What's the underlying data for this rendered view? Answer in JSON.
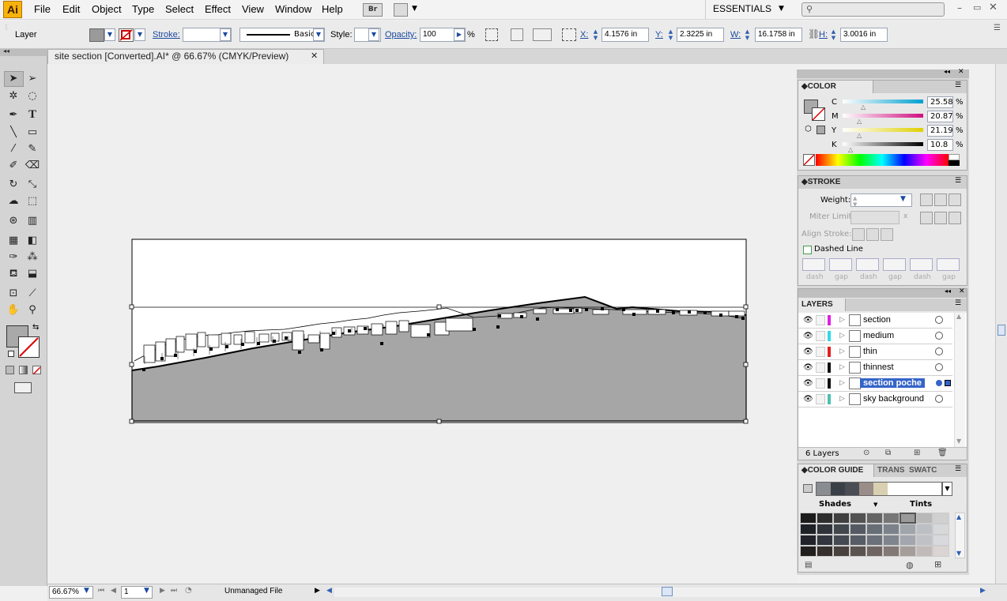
{
  "menubar": {
    "logo": "Ai",
    "items": [
      "File",
      "Edit",
      "Object",
      "Type",
      "Select",
      "Effect",
      "View",
      "Window",
      "Help"
    ],
    "bridge_label": "Br",
    "workspace": "ESSENTIALS",
    "search_placeholder": ""
  },
  "control_bar": {
    "selection_label": "Layer",
    "stroke_label": "Stroke:",
    "brush_label": "Basic",
    "style_label": "Style:",
    "opacity_label": "Opacity:",
    "opacity_value": "100",
    "opacity_unit": "%",
    "x_label": "X:",
    "x_value": "4.1576 in",
    "y_label": "Y:",
    "y_value": "2.3225 in",
    "w_label": "W:",
    "w_value": "16.1758 in",
    "h_label": "H:",
    "h_value": "3.0016 in"
  },
  "document": {
    "tab_title": "site section [Converted].AI* @ 66.67% (CMYK/Preview)",
    "close": "✕"
  },
  "color_panel": {
    "title": "COLOR",
    "channels": [
      {
        "label": "C",
        "value": "25.58",
        "pct": 25.58
      },
      {
        "label": "M",
        "value": "20.87",
        "pct": 20.87
      },
      {
        "label": "Y",
        "value": "21.19",
        "pct": 21.19
      },
      {
        "label": "K",
        "value": "10.8",
        "pct": 10.8
      }
    ],
    "unit": "%"
  },
  "stroke_panel": {
    "title": "STROKE",
    "weight_label": "Weight:",
    "miter_label": "Miter Limit:",
    "miter_unit": "x",
    "align_label": "Align Stroke:",
    "dashed_label": "Dashed Line",
    "dash_labels": [
      "dash",
      "gap",
      "dash",
      "gap",
      "dash",
      "gap"
    ]
  },
  "layers_panel": {
    "title": "LAYERS",
    "layers": [
      {
        "name": "section",
        "color": "#e020e0"
      },
      {
        "name": "medium",
        "color": "#30d8e8"
      },
      {
        "name": "thin",
        "color": "#e02020"
      },
      {
        "name": "thinnest",
        "color": "#101010"
      },
      {
        "name": "section poche",
        "color": "#101010"
      },
      {
        "name": "sky background",
        "color": "#50c0b0"
      }
    ],
    "count": "6 Layers"
  },
  "color_guide_panel": {
    "title": "COLOR GUIDE",
    "tab2": "TRANS",
    "tab3": "SWATC",
    "shades_label": "Shades",
    "tints_label": "Tints"
  },
  "status": {
    "zoom": "66.67%",
    "page": "1",
    "file_status": "Unmanaged File"
  }
}
